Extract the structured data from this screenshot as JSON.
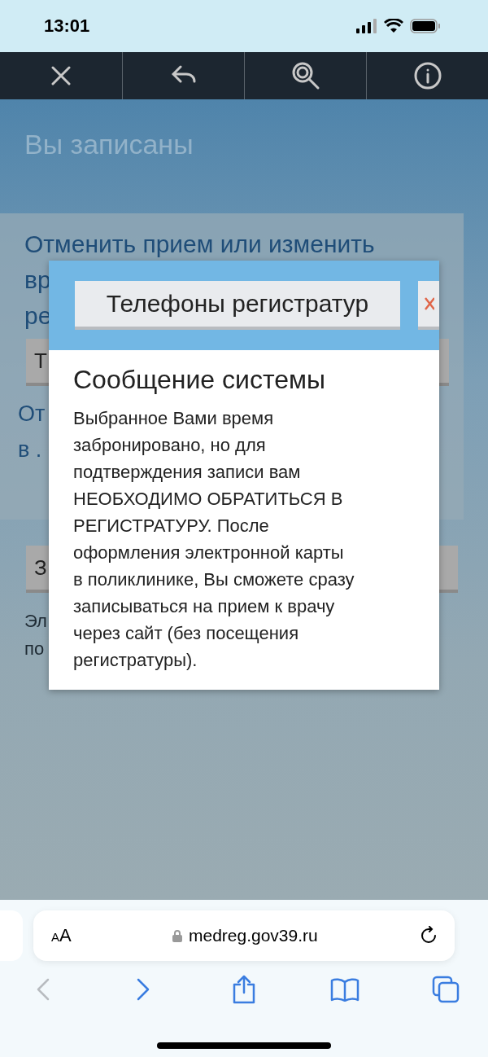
{
  "status_bar": {
    "time": "13:01"
  },
  "toolbar": {
    "buttons": [
      {
        "kind": "close"
      },
      {
        "kind": "back"
      },
      {
        "kind": "search"
      },
      {
        "kind": "info"
      }
    ]
  },
  "page": {
    "title": "Вы записаны",
    "panel": {
      "lines": [
        "Отменить прием или изменить",
        "вр",
        "ре"
      ],
      "button": "Т",
      "lines_after": [
        "От",
        "в ."
      ]
    },
    "button": "З",
    "footer_lines": [
      "Эл",
      "по"
    ]
  },
  "dialog": {
    "header_button": "Телефоны регистратур",
    "title": "Сообщение системы",
    "message_lines": [
      "Выбранное Вами время",
      "забронировано, но для",
      "подтверждения записи вам",
      "НЕОБХОДИМО ОБРАТИТЬСЯ В",
      "РЕГИСТРАТУРУ. После",
      "оформления электронной карты",
      "в поликлинике, Вы сможете сразу",
      "записываться на прием к врачу",
      "через сайт (без посещения",
      "регистратуры)."
    ]
  },
  "browser": {
    "text_size": "AA",
    "url": "medreg.gov39.ru",
    "nav": [
      {
        "kind": "back",
        "disabled": true
      },
      {
        "kind": "forward",
        "disabled": false
      },
      {
        "kind": "share",
        "disabled": false
      },
      {
        "kind": "bookmarks",
        "disabled": false
      },
      {
        "kind": "tabs",
        "disabled": false
      }
    ]
  }
}
